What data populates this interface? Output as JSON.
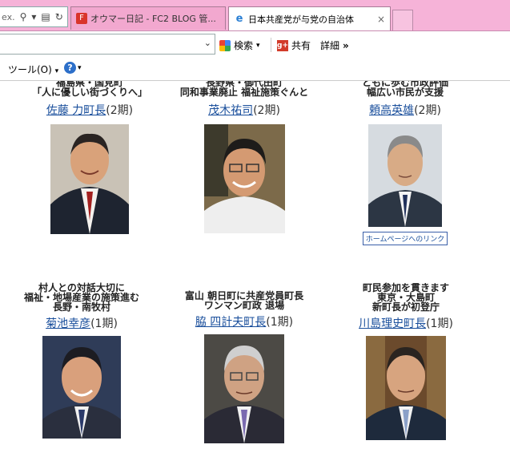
{
  "browser": {
    "address_fragment": "ex.",
    "tabs": [
      {
        "label": "オウマー日記 - FC2 BLOG 管...",
        "active": false
      },
      {
        "label": "日本共産党が与党の自治体",
        "active": true
      }
    ],
    "close_glyph": "×",
    "commands": {
      "search": "検索",
      "share": "共有",
      "details": "詳細"
    },
    "menu": {
      "tools": "ツール(O)",
      "help_glyph": "?"
    }
  },
  "mayors": [
    {
      "headline": [
        "福島県・国見町",
        "「人に優しい街づくりへ」"
      ],
      "name": "佐藤 力町長",
      "term": "(2期)",
      "photo_colors": [
        "#c9c2b6",
        "#1e2430"
      ]
    },
    {
      "headline": [
        "長野県・御代田町",
        "同和事業廃止 福祉施策ぐんと"
      ],
      "name": "茂木祐司",
      "term": "(2期)",
      "photo_colors": [
        "#7c6a4a",
        "#eeeeee"
      ]
    },
    {
      "headline": [
        "ともに歩む市政評価",
        "幅広い市民が支援"
      ],
      "name": "頼高英雄",
      "term": "(2期)",
      "photo_colors": [
        "#d6dbe0",
        "#2c3644"
      ],
      "extra_link": "ホームページへのリンク"
    },
    {
      "headline": [
        "村人との対話大切に",
        "福祉・地場産業の施策進む",
        "長野・南牧村"
      ],
      "name": "菊池幸彦",
      "term": "(1期)",
      "photo_colors": [
        "#2f3c58",
        "#2a2f3e"
      ]
    },
    {
      "headline": [
        "富山 朝日町に共産党員町長",
        "ワンマン町政 退場"
      ],
      "name": "脇 四計夫町長",
      "term": "(1期)",
      "photo_colors": [
        "#4c4a45",
        "#2a2a35"
      ]
    },
    {
      "headline": [
        "町民参加を貫きます",
        "東京・大島町",
        "新町長が初登庁"
      ],
      "name": "川島理史町長",
      "term": "(1期)",
      "photo_colors": [
        "#6b4a2c",
        "#1e2a3c"
      ]
    }
  ]
}
